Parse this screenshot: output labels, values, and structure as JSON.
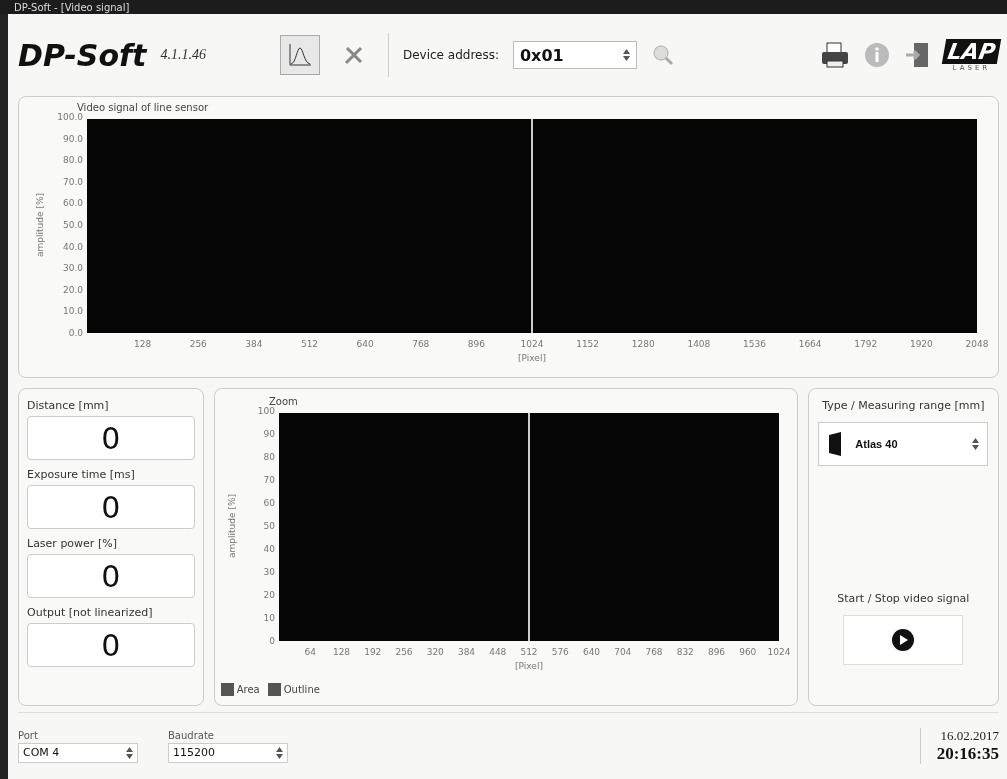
{
  "window": {
    "title": "DP-Soft - [Video signal]"
  },
  "header": {
    "app_name": "DP-Soft",
    "version": "4.1.1.46",
    "device_address_label": "Device address:",
    "device_address": "0x01",
    "logo": "LAP",
    "logo_sub": "LASER"
  },
  "signal_chart": {
    "title": "Video signal of line sensor",
    "xlabel": "[Pixel]",
    "ylabel": "amplitude [%]",
    "xticks": [
      "128",
      "256",
      "384",
      "512",
      "640",
      "768",
      "896",
      "1024",
      "1152",
      "1280",
      "1408",
      "1536",
      "1664",
      "1792",
      "1920",
      "2048"
    ],
    "yticks": [
      "100.0",
      "90.0",
      "80.0",
      "70.0",
      "60.0",
      "50.0",
      "40.0",
      "30.0",
      "20.0",
      "10.0",
      "0.0"
    ]
  },
  "readings": [
    {
      "label": "Distance [mm]",
      "value": "0"
    },
    {
      "label": "Exposure time [ms]",
      "value": "0"
    },
    {
      "label": "Laser power [%]",
      "value": "0"
    },
    {
      "label": "Output [not linearized]",
      "value": "0"
    }
  ],
  "zoom_chart": {
    "title": "Zoom",
    "xlabel": "[Pixel]",
    "ylabel": "amplitude [%]",
    "xticks": [
      "64",
      "128",
      "192",
      "256",
      "320",
      "384",
      "448",
      "512",
      "576",
      "640",
      "704",
      "768",
      "832",
      "896",
      "960",
      "1024"
    ],
    "yticks": [
      "100",
      "90",
      "80",
      "70",
      "60",
      "50",
      "40",
      "30",
      "20",
      "10",
      "0"
    ],
    "options": [
      {
        "label": "Area",
        "checked": true
      },
      {
        "label": "Outline",
        "checked": true
      }
    ]
  },
  "sensor": {
    "label": "Type / Measuring range [mm]",
    "value": "Atlas 40"
  },
  "video": {
    "label": "Start / Stop video signal"
  },
  "status_bar": {
    "port_label": "Port",
    "port": "COM 4",
    "baudrate_label": "Baudrate",
    "baudrate": "115200",
    "date": "16.02.2017",
    "time": "20:16:35"
  }
}
